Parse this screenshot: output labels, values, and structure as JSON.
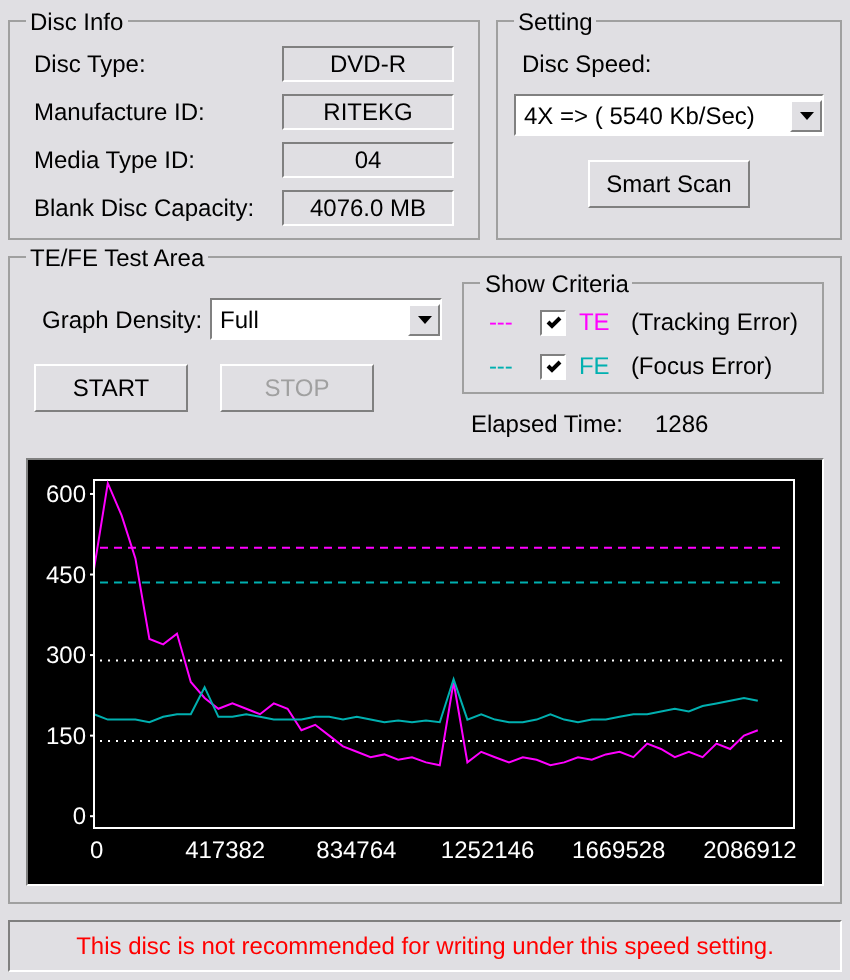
{
  "disc_info": {
    "title": "Disc Info",
    "fields": [
      {
        "label": "Disc Type:",
        "value": "DVD-R"
      },
      {
        "label": "Manufacture ID:",
        "value": "RITEKG"
      },
      {
        "label": "Media Type ID:",
        "value": "04"
      },
      {
        "label": "Blank Disc Capacity:",
        "value": "4076.0 MB"
      }
    ]
  },
  "setting": {
    "title": "Setting",
    "speed_label": "Disc Speed:",
    "speed_value": "4X => ( 5540 Kb/Sec)",
    "smart_scan_button": "Smart Scan"
  },
  "test_area": {
    "title": "TE/FE Test Area",
    "density_label": "Graph Density:",
    "density_value": "Full",
    "show_criteria": {
      "title": "Show Criteria",
      "items": [
        {
          "dash": "---",
          "description": "(Tracking Error)",
          "checked": true
        },
        {
          "dash": "---",
          "description": "(Focus Error)",
          "checked": true
        }
      ]
    },
    "buttons": [
      {
        "label": "START",
        "disabled": false
      },
      {
        "label": "STOP",
        "disabled": true
      }
    ],
    "elapsed_label": "Elapsed Time:",
    "elapsed_value": "1286",
    "chart_data": {
      "type": "line",
      "x": [
        0,
        44000,
        88000,
        132000,
        176000,
        220000,
        264000,
        308000,
        352000,
        396000,
        440000,
        484000,
        528000,
        572000,
        616000,
        660000,
        704000,
        748000,
        792000,
        836000,
        880000,
        924000,
        968000,
        1012000,
        1056000,
        1100000,
        1144000,
        1188000,
        1232000,
        1276000,
        1320000,
        1364000,
        1408000,
        1452000,
        1496000,
        1540000,
        1584000,
        1628000,
        1672000,
        1716000,
        1760000,
        1804000,
        1848000,
        1892000,
        1936000,
        1980000,
        2024000,
        2068000,
        2112000
      ],
      "series": [
        {
          "name": "TE",
          "color": "#ff00ff",
          "values": [
            460,
            620,
            560,
            480,
            330,
            320,
            340,
            250,
            220,
            200,
            210,
            200,
            190,
            210,
            200,
            160,
            170,
            150,
            130,
            120,
            110,
            115,
            105,
            110,
            100,
            95,
            250,
            100,
            120,
            110,
            100,
            110,
            105,
            95,
            100,
            110,
            105,
            115,
            120,
            110,
            135,
            125,
            110,
            120,
            110,
            135,
            125,
            150,
            160
          ]
        },
        {
          "name": "FE",
          "color": "#00b0b0",
          "values": [
            190,
            180,
            180,
            180,
            175,
            185,
            190,
            190,
            240,
            185,
            185,
            190,
            185,
            180,
            180,
            180,
            185,
            185,
            180,
            185,
            180,
            175,
            178,
            175,
            178,
            175,
            255,
            180,
            190,
            180,
            175,
            175,
            180,
            190,
            180,
            175,
            180,
            180,
            185,
            190,
            190,
            195,
            200,
            195,
            205,
            210,
            215,
            220,
            215
          ]
        }
      ],
      "xlim": [
        0,
        2227000
      ],
      "ylim": [
        -22,
        626
      ],
      "xticks": [
        0,
        417382,
        834764,
        1252146,
        1669528,
        2086912
      ],
      "yticks": [
        0,
        150,
        300,
        450,
        600
      ],
      "ref_lines": [
        {
          "axis": "y",
          "value": 500,
          "color": "#ff00ff"
        },
        {
          "axis": "y",
          "value": 435,
          "color": "#00b0b0"
        },
        {
          "axis": "y",
          "value": 290,
          "color": "#ffffff"
        },
        {
          "axis": "y",
          "value": 140,
          "color": "#ffffff"
        }
      ]
    }
  },
  "status_message": "This disc is not recommended for writing under this speed setting."
}
